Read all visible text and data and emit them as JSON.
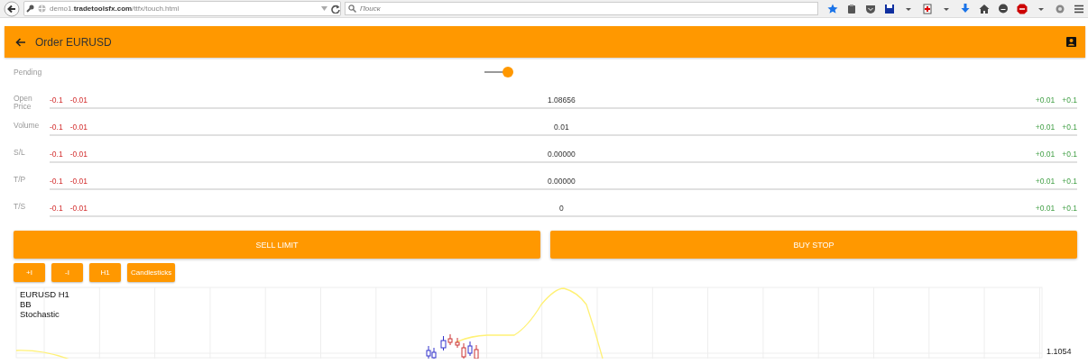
{
  "browser": {
    "url": "demo1.**tradetoolsfx.com**/ttfx/touch.html",
    "search": {
      "placeholder": "Поиск"
    }
  },
  "app_bar": {
    "title": "Order EURUSD"
  },
  "pending": {
    "label": "Pending",
    "on": true
  },
  "fields": [
    {
      "label": "Open Price",
      "decrements": [
        "-0.1",
        "-0.01"
      ],
      "value": "1.08656",
      "increments": [
        "+0.01",
        "+0.1"
      ]
    },
    {
      "label": "Volume",
      "decrements": [
        "-0.1",
        "-0.01"
      ],
      "value": "0.01",
      "increments": [
        "+0.01",
        "+0.1"
      ]
    },
    {
      "label": "S/L",
      "decrements": [
        "-0.1",
        "-0.01"
      ],
      "value": "0.00000",
      "increments": [
        "+0.01",
        "+0.1"
      ]
    },
    {
      "label": "T/P",
      "decrements": [
        "-0.1",
        "-0.01"
      ],
      "value": "0.00000",
      "increments": [
        "+0.01",
        "+0.1"
      ]
    },
    {
      "label": "T/S",
      "decrements": [
        "-0.1",
        "-0.01"
      ],
      "value": "0",
      "increments": [
        "+0.01",
        "+0.1"
      ]
    }
  ],
  "actions": [
    {
      "label": "SELL LIMIT"
    },
    {
      "label": "BUY STOP"
    }
  ],
  "chart_toolbar": [
    {
      "label": "+I"
    },
    {
      "label": "-I"
    },
    {
      "label": "H1"
    },
    {
      "label": "Candlesticks"
    }
  ],
  "chart": {
    "legend": [
      "EURUSD H1",
      "BB",
      "Stochastic"
    ],
    "price_label": "1.1054"
  }
}
